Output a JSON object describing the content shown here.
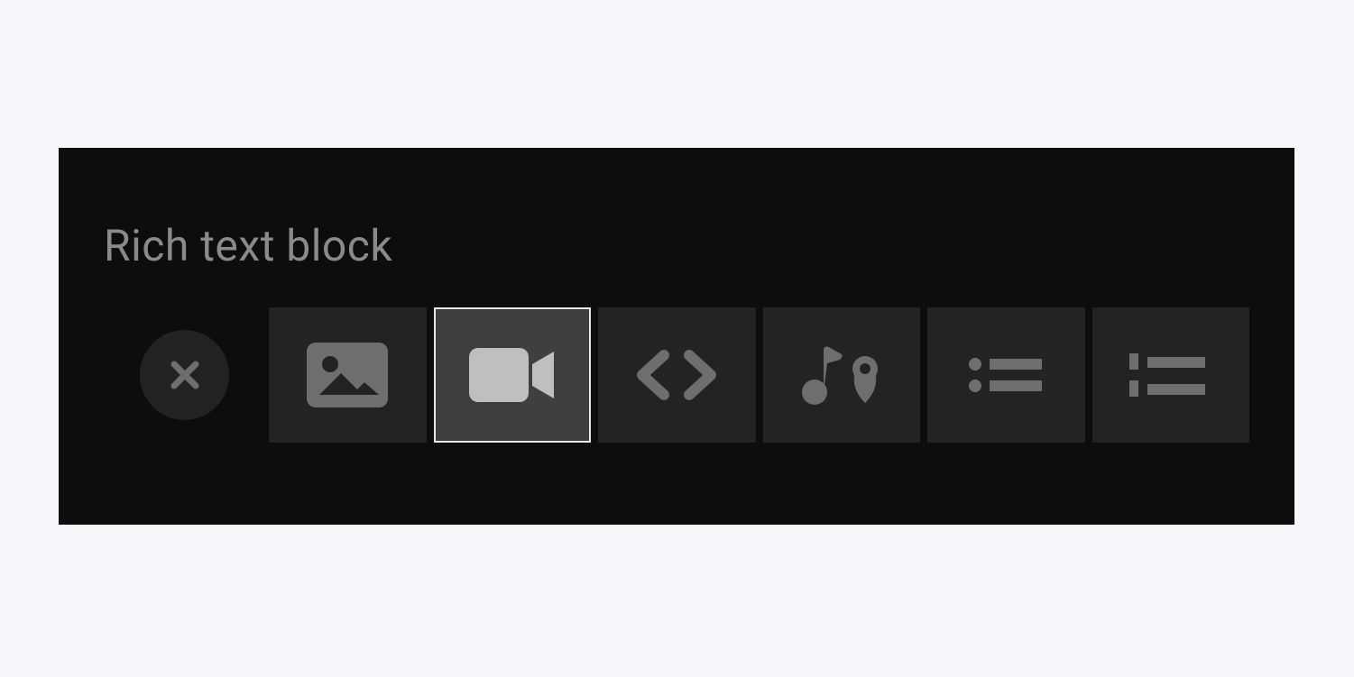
{
  "panel": {
    "title": "Rich text block"
  },
  "toolbar": {
    "close": {
      "name": "close"
    },
    "items": [
      {
        "name": "image",
        "selected": false
      },
      {
        "name": "video",
        "selected": true
      },
      {
        "name": "code",
        "selected": false
      },
      {
        "name": "audio-map",
        "selected": false
      },
      {
        "name": "bulleted-list",
        "selected": false
      },
      {
        "name": "icon-list",
        "selected": false
      }
    ]
  },
  "colors": {
    "pageBg": "#f5f7fa",
    "panelBg": "#0d0d0d",
    "titleText": "#8a8a8a",
    "tileBg": "#232323",
    "tileSelectedBg": "#3f3f3f",
    "tileSelectedBorder": "#e8e8e8",
    "iconMuted": "#6e6e6e",
    "iconBright": "#bfbfbf"
  }
}
